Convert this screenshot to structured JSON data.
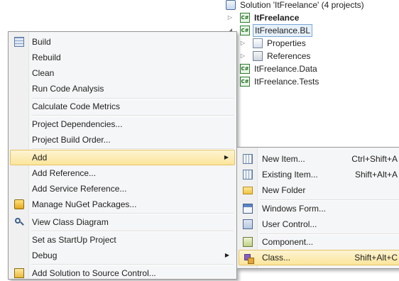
{
  "solution_explorer": {
    "solution": "Solution 'ItFreelance' (4 projects)",
    "items": [
      {
        "label": "ItFreelance",
        "bold": true,
        "icon": "csharp-project-icon",
        "expander": "▷"
      },
      {
        "label": "ItFreelance.BL",
        "selected": true,
        "icon": "csharp-project-icon",
        "expander": "◢"
      },
      {
        "label": "Properties",
        "icon": "properties-icon",
        "expander": "▷"
      },
      {
        "label": "References",
        "icon": "references-icon",
        "expander": "▷"
      },
      {
        "label": "ItFreelance.Data",
        "icon": "csharp-project-icon"
      },
      {
        "label": "ItFreelance.Tests",
        "icon": "csharp-project-icon"
      }
    ],
    "cs_badge": "C#"
  },
  "context_menu": {
    "items": [
      {
        "label": "Build",
        "icon": "build-icon"
      },
      {
        "label": "Rebuild"
      },
      {
        "label": "Clean"
      },
      {
        "label": "Run Code Analysis"
      },
      {
        "label": "Calculate Code Metrics"
      },
      {
        "label": "Project Dependencies..."
      },
      {
        "label": "Project Build Order..."
      },
      {
        "label": "Add",
        "submenu_arrow": "▶",
        "highlighted": true
      },
      {
        "label": "Add Reference..."
      },
      {
        "label": "Add Service Reference..."
      },
      {
        "label": "Manage NuGet Packages...",
        "icon": "nuget-package-icon"
      },
      {
        "label": "View Class Diagram",
        "icon": "class-diagram-icon"
      },
      {
        "label": "Set as StartUp Project"
      },
      {
        "label": "Debug",
        "submenu_arrow": "▶"
      },
      {
        "label": "Add Solution to Source Control...",
        "icon": "source-control-icon"
      }
    ]
  },
  "add_submenu": {
    "items": [
      {
        "label": "New Item...",
        "shortcut": "Ctrl+Shift+A",
        "icon": "new-item-icon"
      },
      {
        "label": "Existing Item...",
        "shortcut": "Shift+Alt+A",
        "icon": "existing-item-icon"
      },
      {
        "label": "New Folder",
        "icon": "new-folder-icon"
      },
      {
        "label": "Windows Form...",
        "icon": "windows-form-icon"
      },
      {
        "label": "User Control...",
        "icon": "user-control-icon"
      },
      {
        "label": "Component...",
        "icon": "component-icon"
      },
      {
        "label": "Class...",
        "shortcut": "Shift+Alt+C",
        "icon": "class-icon",
        "highlighted": true
      }
    ]
  },
  "colors": {
    "menu_background": "#f5f6f7",
    "highlight_top": "#fdf4d2",
    "highlight_bottom": "#fce59b",
    "highlight_border": "#e5c365",
    "selection_border": "#7aa7d8"
  }
}
